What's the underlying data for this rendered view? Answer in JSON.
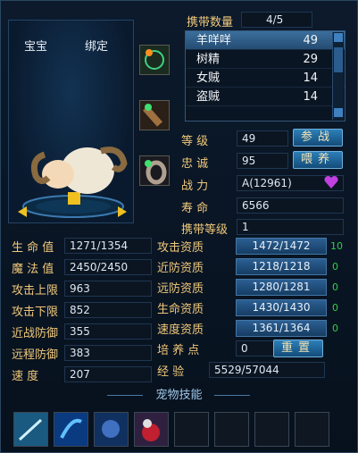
{
  "carry": {
    "label": "携带数量",
    "value": "4/5"
  },
  "tabs": {
    "pet": "宝宝",
    "bind": "绑定"
  },
  "pets": [
    {
      "name": "羊咩咩",
      "level": "49"
    },
    {
      "name": "树精",
      "level": "29"
    },
    {
      "name": "女贼",
      "level": "14"
    },
    {
      "name": "盗贼",
      "level": "14"
    }
  ],
  "info": {
    "level": {
      "label": "等 级",
      "value": "49"
    },
    "loyalty": {
      "label": "忠 诚",
      "value": "95"
    },
    "power": {
      "label": "战 力",
      "value": "A(12961)"
    },
    "life": {
      "label": "寿 命",
      "value": "6566"
    },
    "carry_level": {
      "label": "携带等级",
      "value": "1"
    }
  },
  "buttons": {
    "fight": "参战",
    "feed": "喂养",
    "reset": "重置"
  },
  "stats": [
    {
      "label": "生 命 值",
      "value": "1271/1354"
    },
    {
      "label": "魔 法 值",
      "value": "2450/2450"
    },
    {
      "label": "攻击上限",
      "value": "963"
    },
    {
      "label": "攻击下限",
      "value": "852"
    },
    {
      "label": "近战防御",
      "value": "355"
    },
    {
      "label": "远程防御",
      "value": "383"
    },
    {
      "label": "速    度",
      "value": "207"
    }
  ],
  "aptitudes": [
    {
      "label": "攻击资质",
      "value": "1472/1472",
      "bonus": "10",
      "fill": 1.0
    },
    {
      "label": "近防资质",
      "value": "1218/1218",
      "bonus": "0",
      "fill": 1.0
    },
    {
      "label": "远防资质",
      "value": "1280/1281",
      "bonus": "0",
      "fill": 0.999
    },
    {
      "label": "生命资质",
      "value": "1430/1430",
      "bonus": "0",
      "fill": 1.0
    },
    {
      "label": "速度资质",
      "value": "1361/1364",
      "bonus": "0",
      "fill": 0.998
    }
  ],
  "train": {
    "label": "培 养 点",
    "value": "0"
  },
  "exp": {
    "label": "经    验",
    "value": "5529/57044"
  },
  "skills": {
    "title": "宠物技能"
  },
  "colors": {
    "label": "#f0c87a",
    "bar": "#2c5f93",
    "green": "#2fd04a",
    "heart": "#c040e0"
  }
}
